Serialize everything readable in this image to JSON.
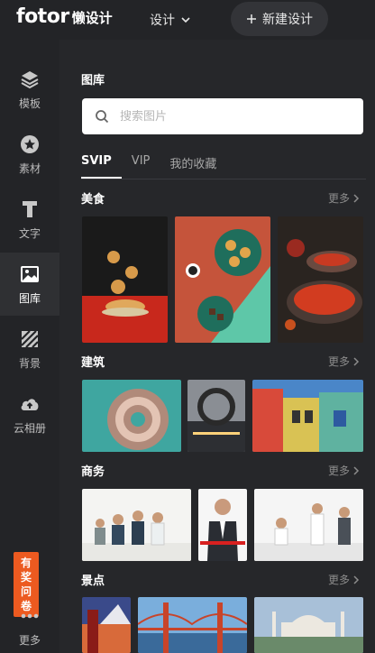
{
  "header": {
    "brand": "fotor",
    "brand_sub": "懒设计",
    "design_menu": "设计",
    "new_design": "新建设计"
  },
  "rail": {
    "items": [
      {
        "label": "模板",
        "icon": "layers-icon"
      },
      {
        "label": "素材",
        "icon": "star-icon"
      },
      {
        "label": "文字",
        "icon": "text-icon"
      },
      {
        "label": "图库",
        "icon": "image-icon",
        "active": true
      },
      {
        "label": "背景",
        "icon": "stripes-icon"
      },
      {
        "label": "云相册",
        "icon": "cloud-upload-icon"
      }
    ],
    "reward": [
      "有",
      "奖",
      "问",
      "卷"
    ],
    "more": "更多"
  },
  "panel": {
    "title": "图库",
    "search_placeholder": "搜索图片",
    "tabs": [
      "SVIP",
      "VIP",
      "我的收藏"
    ],
    "more_label": "更多",
    "sections": [
      {
        "title": "美食"
      },
      {
        "title": "建筑"
      },
      {
        "title": "商务"
      },
      {
        "title": "景点"
      }
    ]
  },
  "colors": {
    "accent_orange": "#ec5a20",
    "background": "#26272a",
    "rail": "#232427"
  }
}
